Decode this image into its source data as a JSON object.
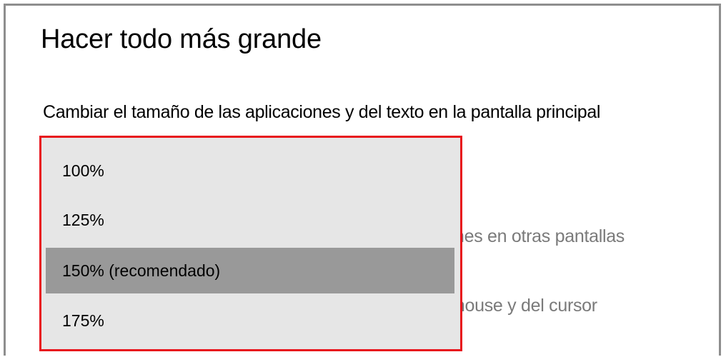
{
  "scaling": {
    "heading": "Hacer todo más grande",
    "description": "Cambiar el tamaño de las aplicaciones y del texto en la pantalla principal",
    "dropdown": {
      "options": [
        {
          "label": "100%"
        },
        {
          "label": "125%"
        },
        {
          "label": "150% (recomendado)"
        },
        {
          "label": "175%"
        }
      ],
      "selected_label": "150% (recomendado)"
    },
    "obscured_settings": [
      {
        "visible_text": "nes en otras pantallas"
      },
      {
        "visible_text": "mouse y del cursor"
      }
    ]
  },
  "colors": {
    "dropdown_background": "#e6e6e6",
    "selected_option_background": "#999999",
    "highlight_border": "#e8141c",
    "window_border": "#8e8e8e"
  }
}
